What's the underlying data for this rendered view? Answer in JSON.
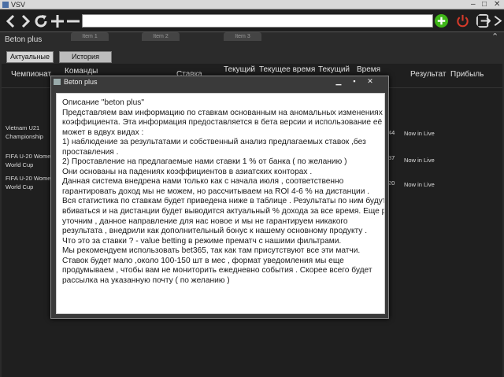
{
  "os_window": {
    "title": "VSV"
  },
  "browser": {
    "url": "",
    "tabs": [
      "Item 1",
      "Item 2",
      "Item 3"
    ]
  },
  "app": {
    "title": "Beton plus",
    "tabs": [
      "Актуальные",
      "История"
    ],
    "columns": [
      "Чемпионат",
      "Команды",
      "Ставка",
      "Текущий",
      "Текущее время",
      "Текущий",
      "Время",
      "Результат",
      "Прибыль"
    ],
    "rows": [
      {
        "championship": [
          "Vietnam U21",
          "Championship"
        ],
        "time_suffix": "44",
        "result": "Now in Live"
      },
      {
        "championship": [
          "FIFA U-20 Women",
          "World Cup"
        ],
        "time_suffix": "37",
        "result": "Now in Live"
      },
      {
        "championship": [
          "FIFA U-20 Women",
          "World Cup"
        ],
        "time_suffix": "20",
        "result": "Now in Live"
      }
    ]
  },
  "dialog": {
    "title": "Beton plus",
    "lines": [
      "Описание \"beton plus\"",
      "Представляем вам информацию по ставкам основанным на аномальных изменениях",
      "коэффициента. Эта информация предоставляется в бета версии и использование её",
      "может в вдвух видах :",
      "1) наблюдение за результатами и собственный анализ предлагаемых ставок ,без",
      "проставления .",
      "2) Проставление на предлагаемые нами ставки  1 % от банка ( по желанию )",
      "Они основаны на падениях коэффициентов в азиатских конторах .",
      "Данная система внедрена нами только как с начала июля , соответственно",
      "гарантировать доход мы не можем, но рассчитываем на ROI 4-6 % на дистанции .",
      "Вся статистика по ставкам будет приведена ниже в таблице . Результаты по ним будут",
      "вбиваться и на дистанции будет выводится актуальный % дохода за все время. Еще раз",
      "уточним , данное направление для нас новое и мы не гарантируем никакого",
      "результата , внедрили как дополнительный бонус к нашему основному продукту .",
      "Что это за ставки ? - value betting в режиме прематч с нашими фильтрами.",
      "Мы рекомендуем использовать bet365, так как там присутствуют все эти матчи.",
      "Ставок будет мало ,около 100-150 шт в мес , формат уведомления мы еще",
      "продумываем , чтобы вам не мониторить ежедневно события . Скорее всего будет",
      "рассылка на указанную почту ( по желанию )"
    ]
  },
  "colors": {
    "add_button": "#3fb618",
    "power_button": "#d43a2a"
  }
}
